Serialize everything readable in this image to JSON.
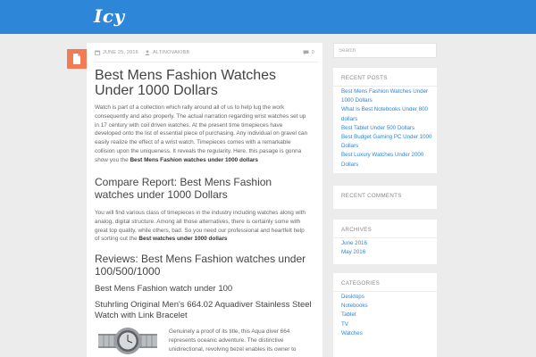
{
  "header": {
    "logo": "Icy",
    "background": "#2d86d8"
  },
  "post": {
    "meta": {
      "date": "JUNE 25, 2016",
      "author": "ALTINOVAKIBB",
      "comments": "0"
    },
    "title": "Best Mens Fashion Watches Under 1000 Dollars",
    "paragraph1": "Watch is part of a collection which rally around all of us to help lug the work consequently and also properly. The actual narration regarding wrist watches set up in 17 century with coil driven watches. At the present time timepieces have developed onto the list of essential piece of purchasing. Any individual on gravel can easily realize the effect of a wrist watch. Timepieces comes with a remarkable collision upon the uniqueness. It reveals the regularity. Here, this pasage is gonna show you the ",
    "paragraph1_bold": "Best Mens Fashion watches under 1000 dollars",
    "heading_compare": "Compare Report: Best Mens Fashion watches under 1000 Dollars",
    "paragraph2": "You will find various class of timepieces in the industry including watches along with analog, digital structure. Among all those alternatives, there is certainly some with great top quality, while others, bad. So you need our professional and heartfelt help of sorting out the ",
    "paragraph2_bold": "Best watches under 1000 dollars",
    "heading_reviews": "Reviews: Best Mens Fashion watches under 100/500/1000",
    "heading_under100": "Best Mens Fashion watch under 100",
    "heading_product": "Stuhrling Original Men's 664.02 Aquadiver Stainless Steel Watch with Link Bracelet",
    "paragraph3": "Genuinely a proof of its title, this Aqua diver 664 represents oceanic adventure. The distinctive unidirectional, revolving bezel enables its owner to"
  },
  "sidebar": {
    "search_placeholder": "Search",
    "recent_posts": {
      "title": "RECENT POSTS",
      "items": [
        "Best Mens Fashion Watches Under 1000 Dollars",
        "What Is Best Notebooks Under 800 dollars",
        "Best Tablet Under 500 Dollars",
        "Best Budget Gaming PC Under 1000 Dollars",
        "Best Luxury Watches Under 2000 Dollars"
      ]
    },
    "recent_comments": {
      "title": "RECENT COMMENTS"
    },
    "archives": {
      "title": "ARCHIVES",
      "items": [
        "June 2016",
        "May 2016"
      ]
    },
    "categories": {
      "title": "CATEGORIES",
      "items": [
        "Desktops",
        "Notebooks",
        "Tablet",
        "TV",
        "Watches"
      ]
    }
  },
  "colors": {
    "accent": "#2d86d8",
    "badge": "#f07b55",
    "background": "#ececec"
  }
}
